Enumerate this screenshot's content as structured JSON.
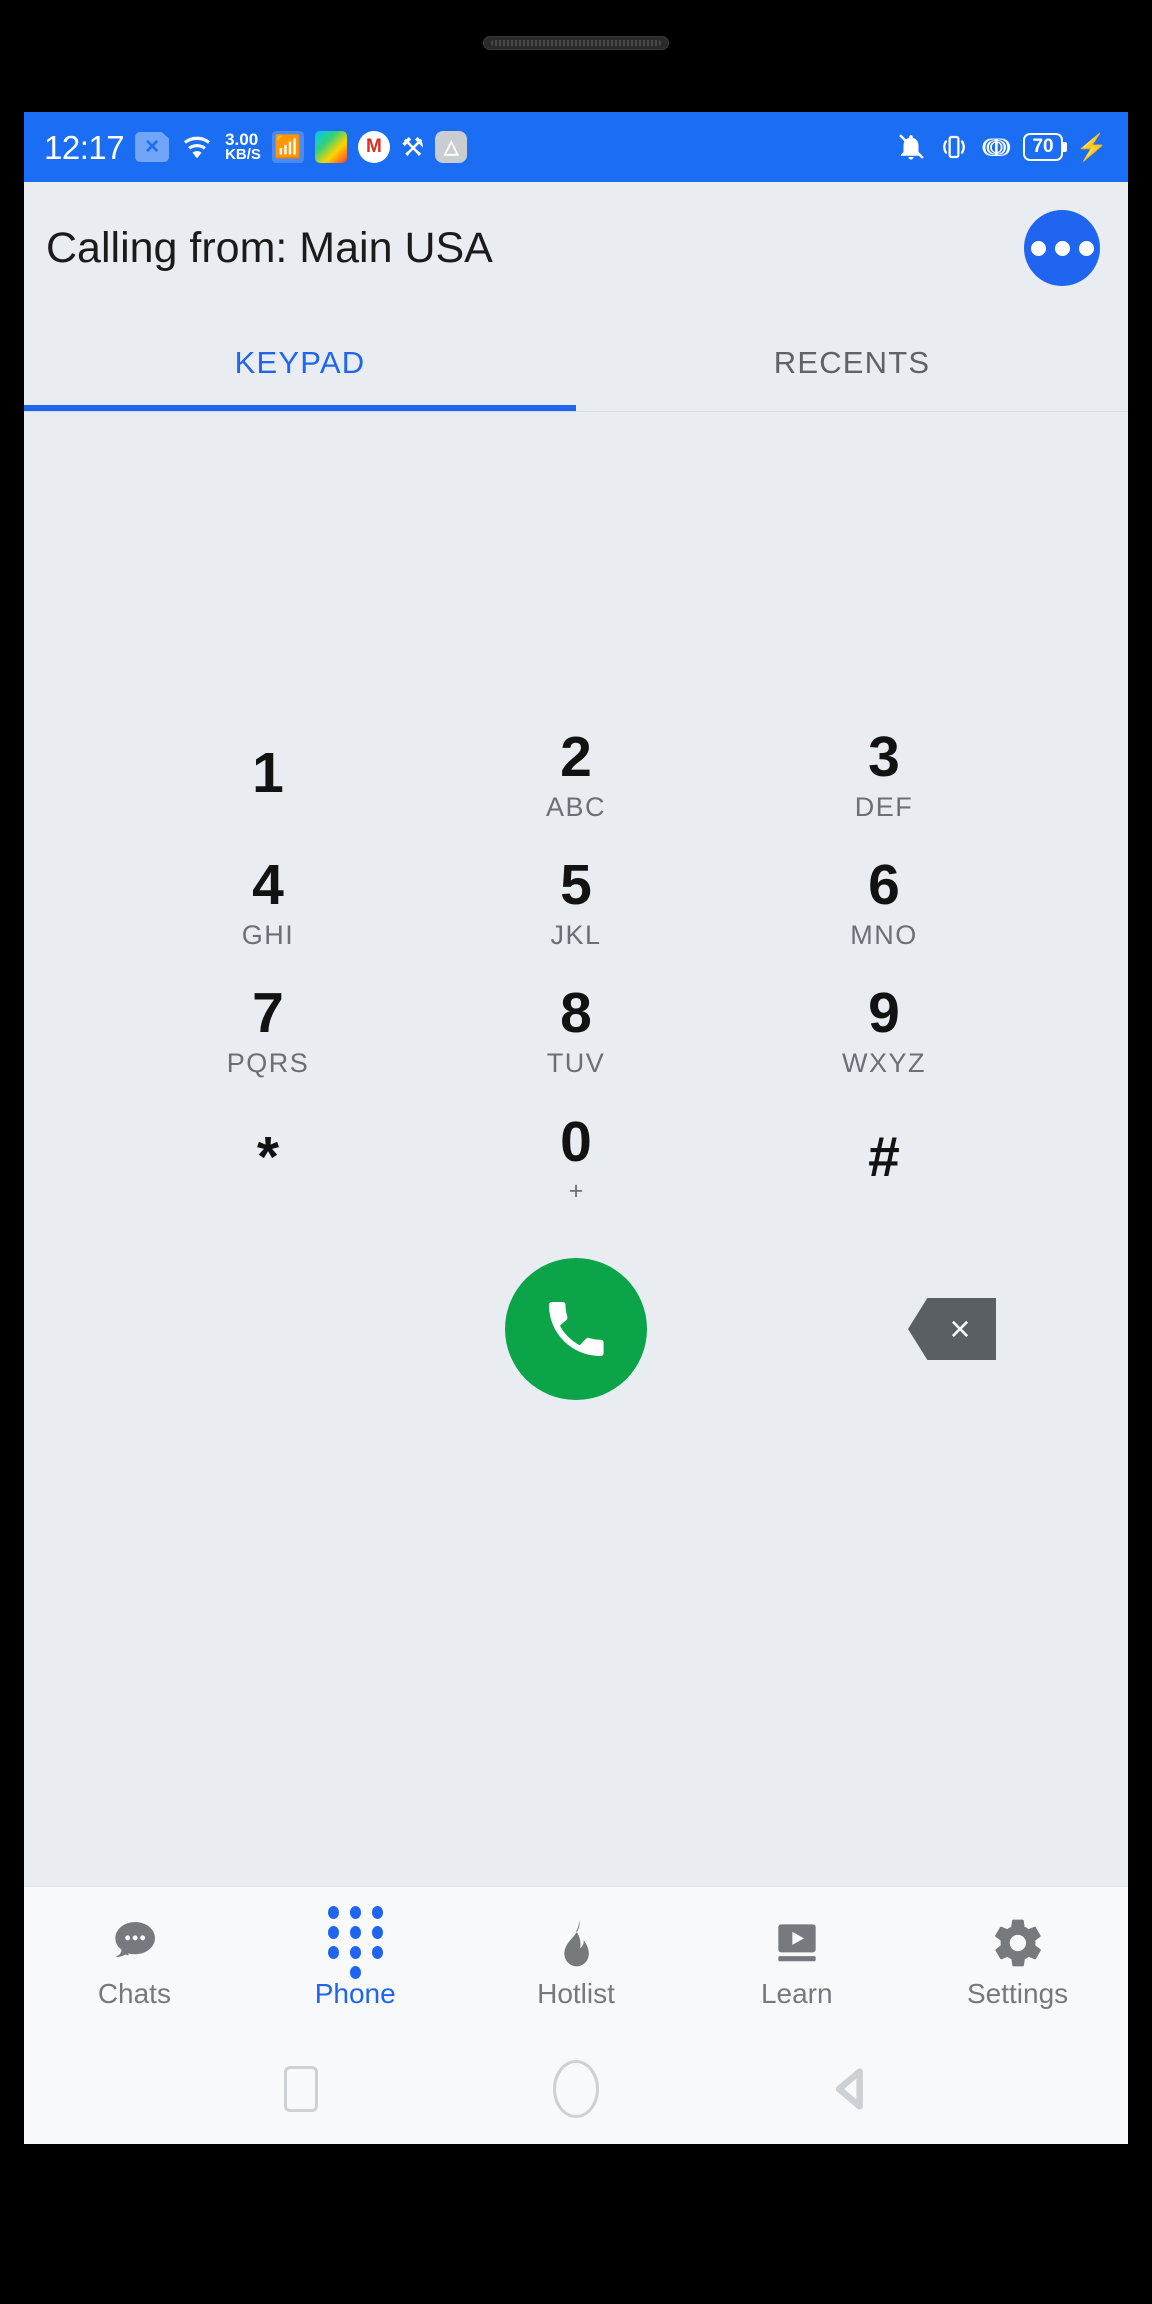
{
  "statusbar": {
    "clock": "12:17",
    "sim_icon": "sim-card-x-icon",
    "wifi_icon": "wifi-icon",
    "network_speed_value": "3.00",
    "network_speed_unit": "KB/S",
    "bluetooth_dots_icon": "bluetooth-data-icon",
    "play_store_icon": "play-store-icon",
    "gmail_icon": "gmail-icon",
    "gmail_letter": "M",
    "usb_icon": "usb-icon",
    "grey_app_icon": "app-notification-icon",
    "mute_icon": "bell-muted-icon",
    "vibrate_icon": "vibrate-icon",
    "bluetooth_icon": "bluetooth-icon",
    "battery_level": "70",
    "charging_icon": "charging-bolt-icon",
    "background_color": "#1b6ef3"
  },
  "header": {
    "title": "Calling from: Main USA",
    "overflow_label": "More options"
  },
  "tabs": [
    {
      "label": "KEYPAD",
      "active": true
    },
    {
      "label": "RECENTS",
      "active": false
    }
  ],
  "dial_display": {
    "value": "",
    "placeholder": ""
  },
  "keypad": {
    "rows": [
      [
        {
          "digit": "1",
          "sub": ""
        },
        {
          "digit": "2",
          "sub": "ABC"
        },
        {
          "digit": "3",
          "sub": "DEF"
        }
      ],
      [
        {
          "digit": "4",
          "sub": "GHI"
        },
        {
          "digit": "5",
          "sub": "JKL"
        },
        {
          "digit": "6",
          "sub": "MNO"
        }
      ],
      [
        {
          "digit": "7",
          "sub": "PQRS"
        },
        {
          "digit": "8",
          "sub": "TUV"
        },
        {
          "digit": "9",
          "sub": "WXYZ"
        }
      ],
      [
        {
          "digit": "*",
          "sub": ""
        },
        {
          "digit": "0",
          "sub": "+"
        },
        {
          "digit": "#",
          "sub": ""
        }
      ]
    ]
  },
  "actions": {
    "call_label": "Call",
    "call_color": "#0ba449",
    "backspace_label": "Backspace",
    "backspace_glyph": "×",
    "backspace_color": "#5a5f63"
  },
  "bottom_nav": {
    "accent_color": "#2065ef",
    "inactive_color": "#76797e",
    "items": [
      {
        "label": "Chats",
        "icon": "chats-icon",
        "active": false
      },
      {
        "label": "Phone",
        "icon": "dialpad-icon",
        "active": true
      },
      {
        "label": "Hotlist",
        "icon": "flame-icon",
        "active": false
      },
      {
        "label": "Learn",
        "icon": "video-icon",
        "active": false
      },
      {
        "label": "Settings",
        "icon": "gear-icon",
        "active": false
      }
    ]
  },
  "android_nav": {
    "recents_label": "Recents",
    "home_label": "Home",
    "back_label": "Back"
  }
}
